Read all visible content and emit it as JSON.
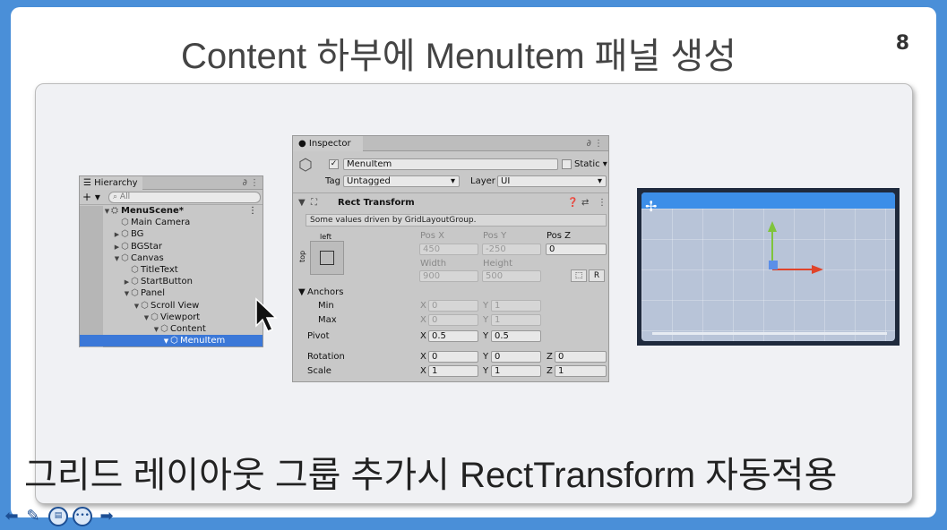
{
  "slide": {
    "title": "Content 하부에 MenuItem 패널 생성",
    "page_number": "8",
    "caption": "그리드 레이아웃 그룹 추가시 RectTransform 자동적용"
  },
  "hierarchy": {
    "tab_label": "Hierarchy",
    "search_placeholder": "All",
    "add_label": "+ ▾",
    "rows": [
      {
        "label": "MenuScene*",
        "depth": 0,
        "arrow": "▼",
        "icon": "scene-icon"
      },
      {
        "label": "Main Camera",
        "depth": 1,
        "arrow": "",
        "icon": "gameobject-icon"
      },
      {
        "label": "BG",
        "depth": 1,
        "arrow": "▶",
        "icon": "gameobject-icon"
      },
      {
        "label": "BGStar",
        "depth": 1,
        "arrow": "▶",
        "icon": "gameobject-icon"
      },
      {
        "label": "Canvas",
        "depth": 1,
        "arrow": "▼",
        "icon": "gameobject-icon"
      },
      {
        "label": "TitleText",
        "depth": 2,
        "arrow": "",
        "icon": "gameobject-icon"
      },
      {
        "label": "StartButton",
        "depth": 2,
        "arrow": "▶",
        "icon": "gameobject-icon"
      },
      {
        "label": "Panel",
        "depth": 2,
        "arrow": "▼",
        "icon": "gameobject-icon"
      },
      {
        "label": "Scroll View",
        "depth": 3,
        "arrow": "▼",
        "icon": "gameobject-icon"
      },
      {
        "label": "Viewport",
        "depth": 4,
        "arrow": "▼",
        "icon": "gameobject-icon"
      },
      {
        "label": "Content",
        "depth": 5,
        "arrow": "▼",
        "icon": "gameobject-icon"
      },
      {
        "label": "MenuItem",
        "depth": 6,
        "arrow": "▼",
        "icon": "gameobject-icon",
        "selected": true
      }
    ]
  },
  "inspector": {
    "tab_label": "Inspector",
    "object_name": "MenuItem",
    "static_label": "Static ▾",
    "tag_label": "Tag",
    "tag_value": "Untagged",
    "layer_label": "Layer",
    "layer_value": "UI",
    "component_title": "Rect Transform",
    "driven_note": "Some values driven by GridLayoutGroup.",
    "anchor_h": "left",
    "anchor_v": "top",
    "pos_x_label": "Pos X",
    "pos_y_label": "Pos Y",
    "pos_z_label": "Pos Z",
    "pos_x": "450",
    "pos_y": "-250",
    "pos_z": "0",
    "width_label": "Width",
    "height_label": "Height",
    "width": "900",
    "height": "500",
    "r_button": "R",
    "anchors_label": "Anchors",
    "min_label": "Min",
    "max_label": "Max",
    "min_x": "0",
    "min_y": "1",
    "max_x": "0",
    "max_y": "1",
    "pivot_label": "Pivot",
    "pivot_x": "0.5",
    "pivot_y": "0.5",
    "rotation_label": "Rotation",
    "rot_x": "0",
    "rot_y": "0",
    "rot_z": "0",
    "scale_label": "Scale",
    "scale_x": "1",
    "scale_y": "1",
    "scale_z": "1",
    "x": "X",
    "y": "Y",
    "z": "Z"
  },
  "colors": {
    "slide_frame": "#4a8fd8",
    "selection": "#3b78d8",
    "scene_header": "#3c8ee8",
    "gizmo_x": "#e0442a",
    "gizmo_y": "#7fc43b",
    "gizmo_center": "#5b8fe8"
  }
}
